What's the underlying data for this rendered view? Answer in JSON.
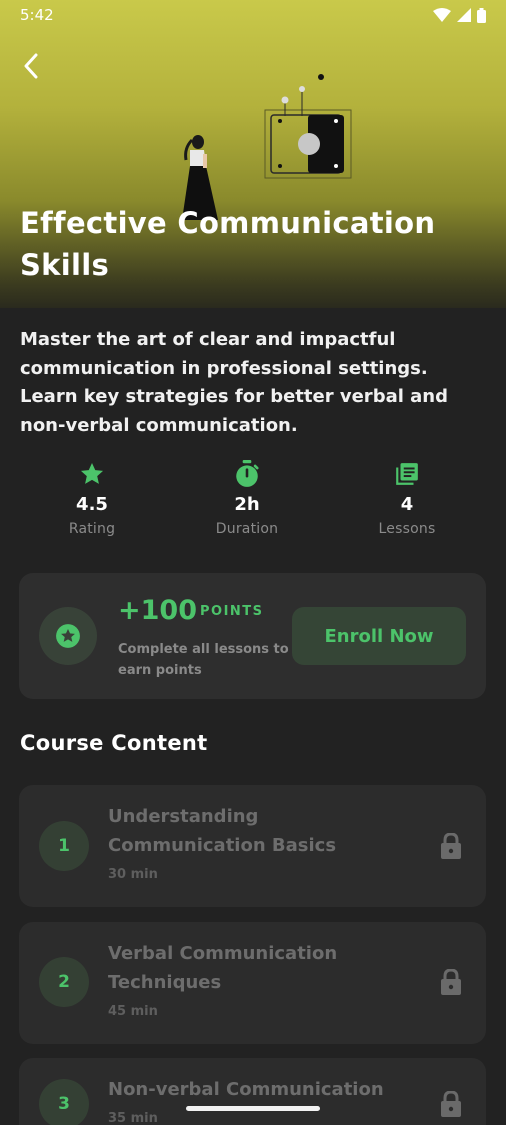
{
  "status_bar": {
    "time": "5:42"
  },
  "hero": {
    "title": "Effective Communication Skills",
    "gradient_top": "#c9c94a",
    "gradient_bottom": "#2a2a1e"
  },
  "description": "Master the art of clear and impactful communication in professional settings. Learn key strategies for better verbal and non-verbal communication.",
  "stats": [
    {
      "icon": "star-icon",
      "value": "4.5",
      "label": "Rating"
    },
    {
      "icon": "timer-icon",
      "value": "2h",
      "label": "Duration"
    },
    {
      "icon": "library-books-icon",
      "value": "4",
      "label": "Lessons"
    }
  ],
  "points": {
    "amount": "+100",
    "word": "POINTS",
    "caption": "Complete all lessons to earn points",
    "enroll_label": "Enroll Now"
  },
  "course_content": {
    "heading": "Course Content",
    "lessons": [
      {
        "number": "1",
        "title": "Understanding Communication Basics",
        "duration": "30 min",
        "locked": true
      },
      {
        "number": "2",
        "title": "Verbal Communication Techniques",
        "duration": "45 min",
        "locked": true
      },
      {
        "number": "3",
        "title": "Non-verbal Communication",
        "duration": "35 min",
        "locked": true
      }
    ]
  },
  "colors": {
    "accent": "#4cc36a",
    "background": "#222222",
    "card": "#2e2e2e"
  }
}
